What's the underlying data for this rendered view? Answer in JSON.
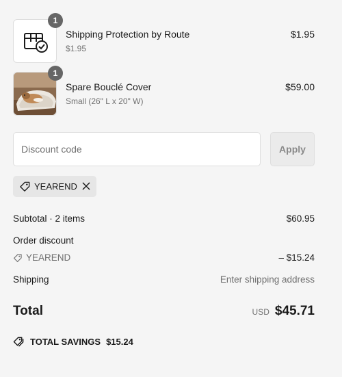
{
  "line_items": [
    {
      "name": "Shipping Protection by Route",
      "subtitle": "$1.95",
      "price": "$1.95",
      "quantity": "1",
      "thumbnail_icon": "box-check-icon"
    },
    {
      "name": "Spare Bouclé Cover",
      "subtitle": "Small (26\" L x 20\" W)",
      "price": "$59.00",
      "quantity": "1",
      "thumbnail_icon": "dog-bed-photo"
    }
  ],
  "discount": {
    "placeholder": "Discount code",
    "apply_label": "Apply",
    "applied_code": "YEAREND"
  },
  "summary": {
    "subtotal_label": "Subtotal · 2 items",
    "subtotal_value": "$60.95",
    "order_discount_label": "Order discount",
    "discount_code": "YEAREND",
    "discount_value": "– $15.24",
    "shipping_label": "Shipping",
    "shipping_value": "Enter shipping address",
    "total_label": "Total",
    "currency": "USD",
    "total_value": "$45.71",
    "savings_label": "TOTAL SAVINGS",
    "savings_value": "$15.24"
  },
  "colors": {
    "background": "#f5f5f5",
    "badge": "#666666",
    "muted_text": "#707070",
    "chip_bg": "#e6e6e6",
    "button_disabled_bg": "#ebebeb"
  }
}
